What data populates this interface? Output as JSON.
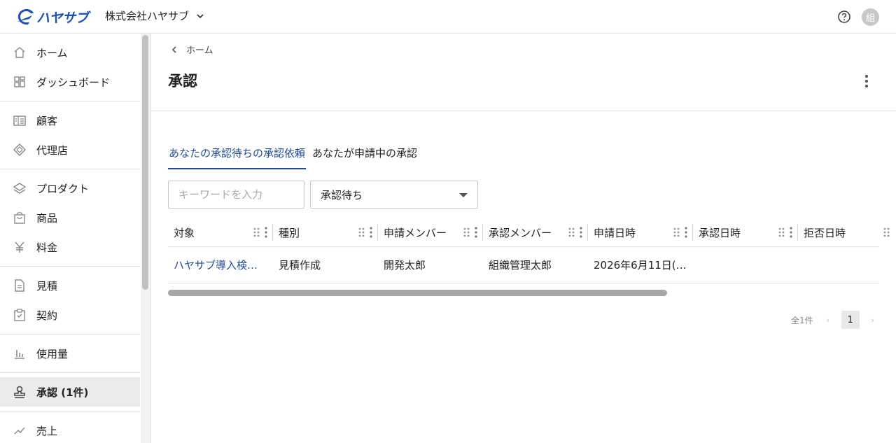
{
  "header": {
    "logo_text": "ハヤサブ",
    "org_name": "株式会社ハヤサブ",
    "avatar_initial": "組"
  },
  "sidebar": {
    "groups": [
      [
        {
          "label": "ホーム",
          "icon": "home-icon"
        },
        {
          "label": "ダッシュボード",
          "icon": "dashboard-icon"
        }
      ],
      [
        {
          "label": "顧客",
          "icon": "customers-icon"
        },
        {
          "label": "代理店",
          "icon": "partner-icon"
        }
      ],
      [
        {
          "label": "プロダクト",
          "icon": "layers-icon"
        },
        {
          "label": "商品",
          "icon": "bag-icon"
        },
        {
          "label": "料金",
          "icon": "yen-icon"
        }
      ],
      [
        {
          "label": "見積",
          "icon": "document-icon"
        },
        {
          "label": "契約",
          "icon": "clipboard-check-icon"
        }
      ],
      [
        {
          "label": "使用量",
          "icon": "bar-chart-icon"
        }
      ],
      [
        {
          "label": "承認 (1件)",
          "icon": "stamp-icon",
          "active": true
        }
      ],
      [
        {
          "label": "売上",
          "icon": "sales-icon"
        }
      ]
    ]
  },
  "breadcrumb": {
    "label": "ホーム"
  },
  "page": {
    "title": "承認"
  },
  "tabs": [
    {
      "label": "あなたの承認待ちの承認依頼",
      "active": true
    },
    {
      "label": "あなたが申請中の承認",
      "active": false
    }
  ],
  "filters": {
    "search_placeholder": "キーワードを入力",
    "status_value": "承認待ち"
  },
  "table": {
    "columns": [
      "対象",
      "種別",
      "申請メンバー",
      "承認メンバー",
      "申請日時",
      "承認日時",
      "拒否日時"
    ],
    "rows": [
      [
        "ハヤサブ導入検…",
        "見積作成",
        "開発太郎",
        "組織管理太郎",
        "2026年6月11日(…",
        "",
        ""
      ]
    ]
  },
  "pagination": {
    "total": "全1件",
    "current": "1"
  },
  "colors": {
    "brand": "#1d4fb8",
    "link": "#1d4a9a"
  }
}
